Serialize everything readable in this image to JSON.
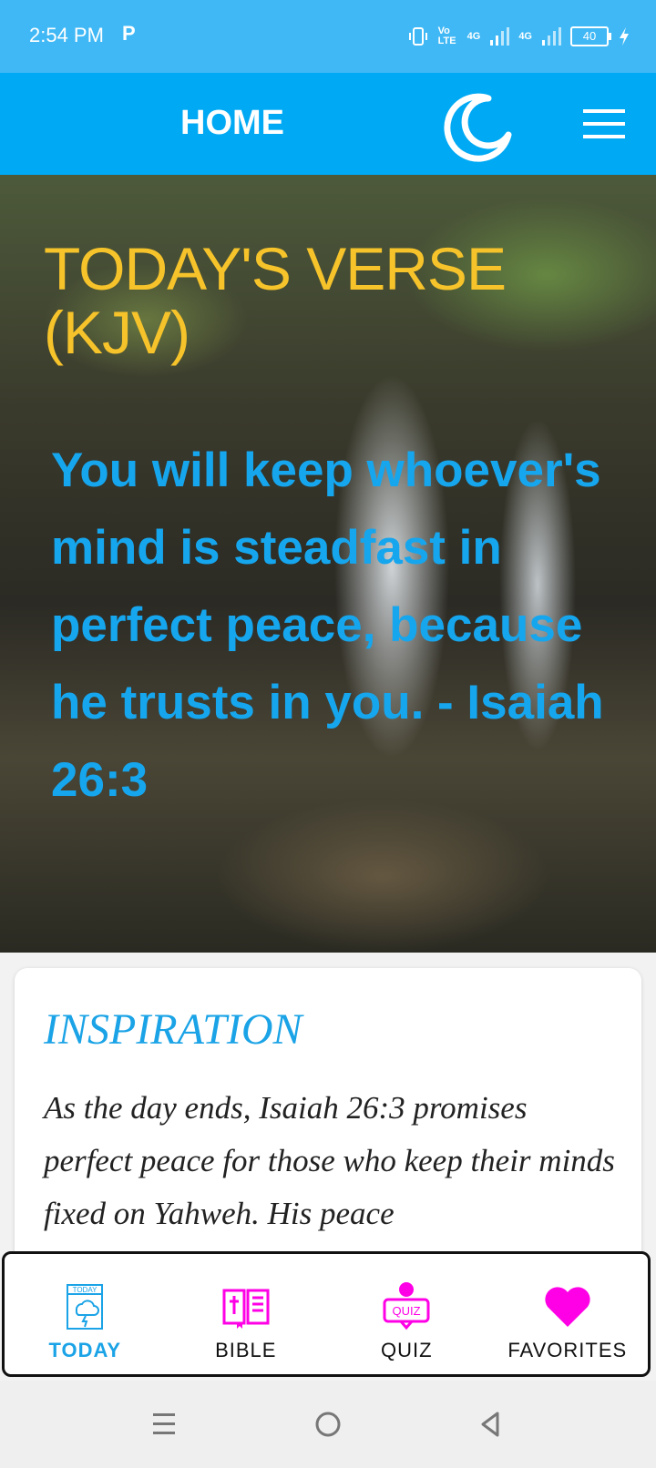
{
  "status_bar": {
    "time": "2:54 PM",
    "notification_icon": "P",
    "network_1": "4G",
    "network_2": "4G",
    "volte": "Vo LTE",
    "battery": "40"
  },
  "app_bar": {
    "title": "HOME",
    "theme_icon": "moon-icon",
    "menu_icon": "hamburger-menu-icon"
  },
  "hero": {
    "title": "TODAY'S VERSE (KJV)",
    "verse": "You will keep whoever's mind is steadfast in perfect peace, because he trusts in you. - Isaiah 26:3"
  },
  "inspiration": {
    "title": "INSPIRATION",
    "text": "As the day ends, Isaiah 26:3 promises perfect peace for those who keep their minds fixed on Yahweh. His peace"
  },
  "bottom_nav": {
    "items": [
      {
        "label": "TODAY",
        "icon": "today-calendar-icon",
        "active": true
      },
      {
        "label": "BIBLE",
        "icon": "bible-book-icon",
        "active": false
      },
      {
        "label": "QUIZ",
        "icon": "quiz-icon",
        "active": false
      },
      {
        "label": "FAVORITES",
        "icon": "heart-icon",
        "active": false
      }
    ]
  },
  "colors": {
    "accent": "#00a9f4",
    "verse": "#16a6ee",
    "title_gold": "#f6c32b",
    "nav_magenta": "#ff00e6"
  }
}
